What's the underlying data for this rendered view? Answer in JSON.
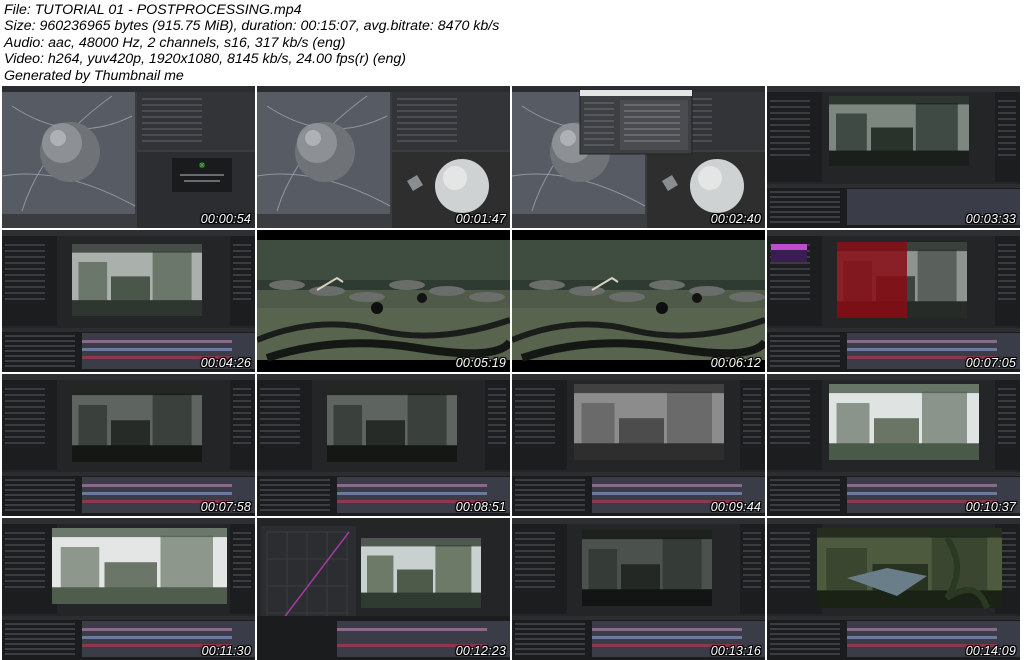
{
  "header": {
    "file_line": "File: TUTORIAL 01 - POSTPROCESSING.mp4",
    "size_line": "Size: 960236965 bytes (915.75 MiB), duration: 00:15:07, avg.bitrate: 8470 kb/s",
    "audio_line": "Audio: aac, 48000 Hz, 2 channels, s16, 317 kb/s (eng)",
    "video_line": "Video: h264, yuv420p, 1920x1080, 8145 kb/s, 24.00 fps(r) (eng)",
    "generated_line": "Generated by Thumbnail me"
  },
  "thumbnails": [
    {
      "time": "00:00:54",
      "scene": "c4d-sphere-dialog"
    },
    {
      "time": "00:01:47",
      "scene": "c4d-sphere-render"
    },
    {
      "time": "00:02:40",
      "scene": "c4d-sphere-window"
    },
    {
      "time": "00:03:33",
      "scene": "ae-tunnel"
    },
    {
      "time": "00:04:26",
      "scene": "ae-ruins-small"
    },
    {
      "time": "00:05:19",
      "scene": "swamp-render"
    },
    {
      "time": "00:06:12",
      "scene": "swamp-render-2"
    },
    {
      "time": "00:07:05",
      "scene": "ae-red-mask"
    },
    {
      "time": "00:07:58",
      "scene": "ae-dark-tunnel"
    },
    {
      "time": "00:08:51",
      "scene": "ae-dark-tunnel"
    },
    {
      "time": "00:09:44",
      "scene": "ae-gray-debris"
    },
    {
      "time": "00:10:37",
      "scene": "ae-bright-city"
    },
    {
      "time": "00:11:30",
      "scene": "ae-bright-city-2"
    },
    {
      "time": "00:12:23",
      "scene": "ae-curves"
    },
    {
      "time": "00:13:16",
      "scene": "ae-dark-tunnel-2"
    },
    {
      "time": "00:14:09",
      "scene": "ae-jungle"
    }
  ]
}
